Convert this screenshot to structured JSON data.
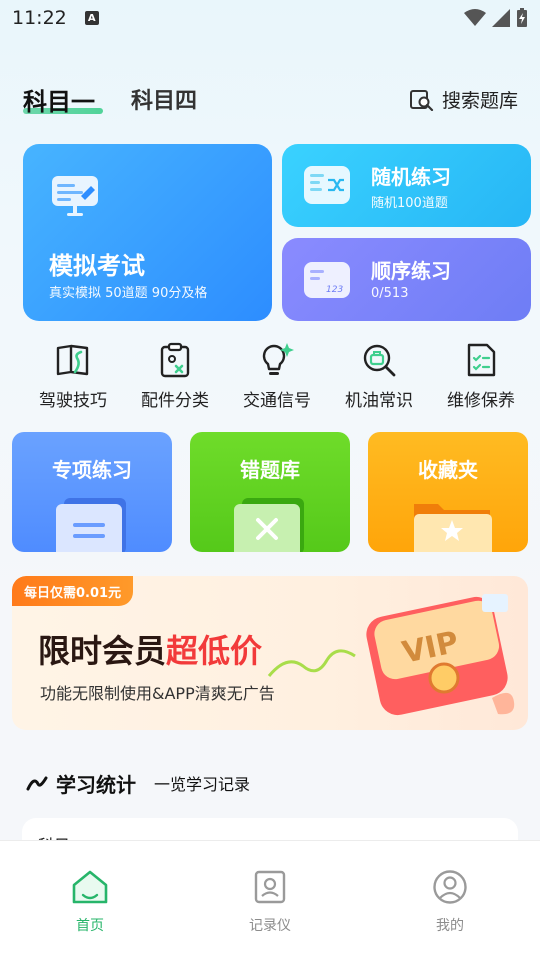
{
  "status_bar": {
    "time": "11:22",
    "notification_badge": "A"
  },
  "header": {
    "tabs": [
      {
        "label": "科目一",
        "active": true
      },
      {
        "label": "科目四",
        "active": false
      }
    ],
    "search_label": "搜索题库"
  },
  "cards": {
    "mock_exam": {
      "title": "模拟考试",
      "subtitle": "真实模拟 50道题 90分及格"
    },
    "random_practice": {
      "title": "随机练习",
      "subtitle": "随机100道题"
    },
    "sequential_practice": {
      "title": "顺序练习",
      "subtitle": "0/513",
      "icon_text": "123"
    }
  },
  "categories": [
    {
      "label": "驾驶技巧",
      "icon": "book-road-icon"
    },
    {
      "label": "配件分类",
      "icon": "clipboard-icon"
    },
    {
      "label": "交通信号",
      "icon": "lightbulb-icon"
    },
    {
      "label": "机油常识",
      "icon": "search-oil-icon"
    },
    {
      "label": "维修保养",
      "icon": "checklist-icon"
    }
  ],
  "tiles": [
    {
      "label": "专项练习",
      "color": "#5b95ff"
    },
    {
      "label": "错题库",
      "color": "#61d323"
    },
    {
      "label": "收藏夹",
      "color": "#ffad14"
    }
  ],
  "banner": {
    "badge": "每日仅需0.01元",
    "title_part1": "限时会员",
    "title_part2": "超低价",
    "subtitle": "功能无限制使用&APP清爽无广告",
    "vip_text": "VIP"
  },
  "stats": {
    "title": "学习统计",
    "link": "一览学习记录",
    "peek_text": "科目一"
  },
  "bottom_nav": [
    {
      "label": "首页",
      "active": true
    },
    {
      "label": "记录仪",
      "active": false
    },
    {
      "label": "我的",
      "active": false
    }
  ],
  "colors": {
    "accent_green": "#27b56a",
    "accent_blue": "#2d8dff"
  }
}
